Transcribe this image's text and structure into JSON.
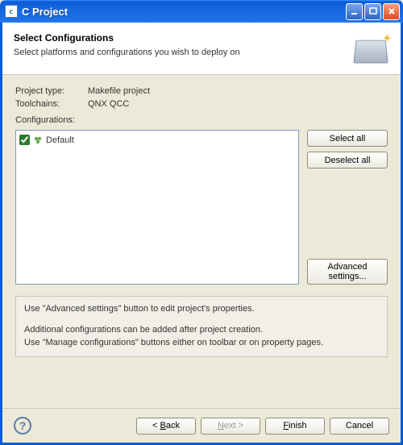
{
  "window": {
    "title": "C Project"
  },
  "header": {
    "title": "Select Configurations",
    "subtitle": "Select platforms and configurations you wish to deploy on"
  },
  "meta": {
    "project_type_label": "Project type:",
    "project_type_value": "Makefile project",
    "toolchains_label": "Toolchains:",
    "toolchains_value": "QNX QCC",
    "configurations_label": "Configurations:"
  },
  "configs": {
    "items": [
      {
        "label": "Default",
        "checked": true
      }
    ]
  },
  "buttons": {
    "select_all": "Select all",
    "deselect_all": "Deselect all",
    "advanced": "Advanced settings...",
    "back": "< Back",
    "next": "Next >",
    "finish": "Finish",
    "cancel": "Cancel"
  },
  "info": {
    "line1": "Use \"Advanced settings\" button to edit project's properties.",
    "line2": "Additional configurations can be added after project creation.",
    "line3": "Use \"Manage configurations\" buttons either on toolbar or on property pages."
  }
}
